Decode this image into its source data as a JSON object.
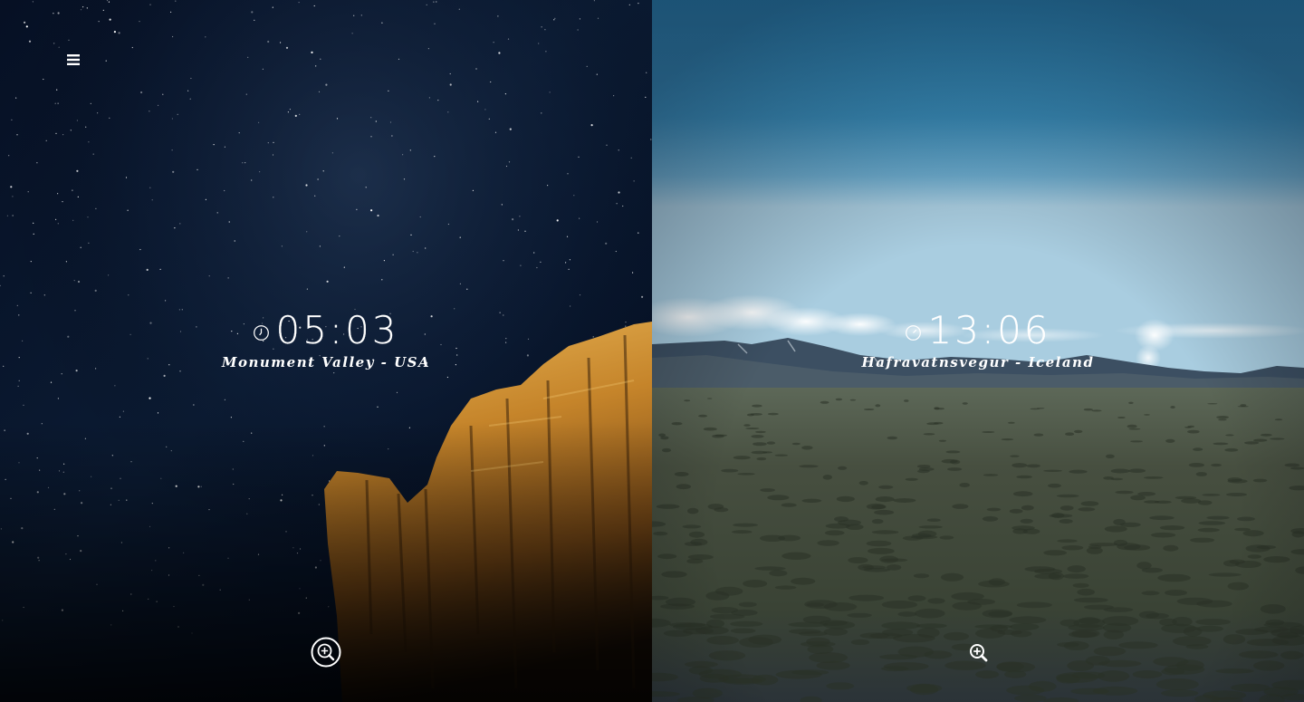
{
  "menu": {
    "icon": "hamburger-menu-icon"
  },
  "panels": [
    {
      "time": "05:03",
      "location": "Monument Valley - USA",
      "clock_icon": "clock-icon",
      "zoom_icon": "zoom-in-icon",
      "zoom_style": "circled"
    },
    {
      "time": "13:06",
      "location": "Hafravatnsvegur - Iceland",
      "clock_icon": "clock-icon",
      "zoom_icon": "zoom-in-icon",
      "zoom_style": "plain"
    }
  ],
  "colors": {
    "night_sky": "#050d1c",
    "rock": "#c98a2c",
    "day_sky": "#2f87b7",
    "ground": "#3a4234",
    "text": "#ffffff"
  }
}
